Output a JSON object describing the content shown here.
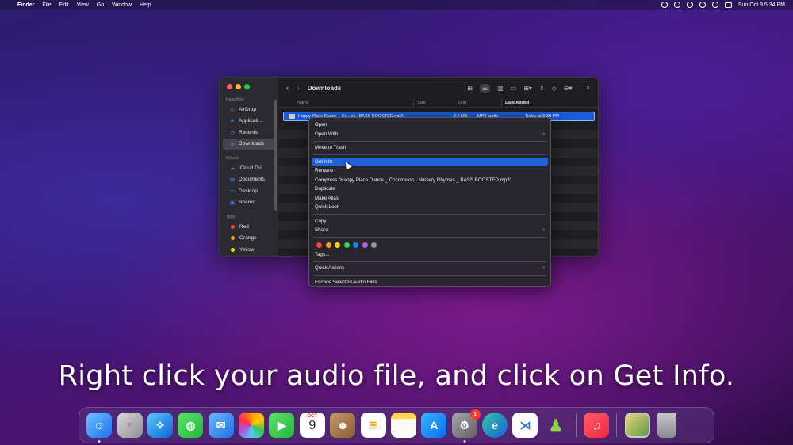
{
  "menubar": {
    "app_name": "Finder",
    "menus": [
      "File",
      "Edit",
      "View",
      "Go",
      "Window",
      "Help"
    ],
    "clock": "Sun Oct 9  5:34 PM"
  },
  "finder": {
    "folder_title": "Downloads",
    "sidebar": {
      "favorites_header": "Favorites",
      "favorites": [
        {
          "label": "AirDrop",
          "icon": "airdrop-icon"
        },
        {
          "label": "Applicati...",
          "icon": "applications-icon"
        },
        {
          "label": "Recents",
          "icon": "clock-icon"
        },
        {
          "label": "Downloads",
          "icon": "download-icon"
        }
      ],
      "icloud_header": "iCloud",
      "icloud": [
        {
          "label": "iCloud Dri...",
          "icon": "cloud-icon"
        },
        {
          "label": "Documents",
          "icon": "document-icon"
        },
        {
          "label": "Desktop",
          "icon": "desktop-icon"
        },
        {
          "label": "Shared",
          "icon": "shared-folder-icon"
        }
      ],
      "tags_header": "Tags",
      "tags": [
        {
          "label": "Red",
          "color": "#ff453a"
        },
        {
          "label": "Orange",
          "color": "#ff9f0a"
        },
        {
          "label": "Yellow",
          "color": "#ffd60a"
        }
      ]
    },
    "columns": [
      "Name",
      "Size",
      "Kind",
      "Date Added"
    ],
    "selected_file": {
      "name": "Happy Place Dance _ Co...es_ BASS BOOSTED.mp3",
      "size": "2.6 MB",
      "kind": "MP3 audio",
      "date_added": "Today at 5:30 PM"
    }
  },
  "context_menu": {
    "open": "Open",
    "open_with": "Open With",
    "move_to_trash": "Move to Trash",
    "get_info": "Get Info",
    "rename": "Rename",
    "compress": "Compress \"Happy Place Dance _ Cocomelon - Nursery Rhymes _ BASS BOOSTED.mp3\"",
    "duplicate": "Duplicate",
    "make_alias": "Make Alias",
    "quick_look": "Quick Look",
    "copy": "Copy",
    "share": "Share",
    "tag_colors": [
      "#ff453a",
      "#ff9f0a",
      "#ffd60a",
      "#32d74b",
      "#0a84ff",
      "#bf5af2",
      "#98989d"
    ],
    "tags": "Tags...",
    "quick_actions": "Quick Actions",
    "encode": "Encode Selected Audio Files"
  },
  "caption": "Right click your audio file, and click on Get Info.",
  "dock": {
    "calendar_month": "OCT",
    "calendar_day": "9",
    "settings_badge": "1"
  }
}
